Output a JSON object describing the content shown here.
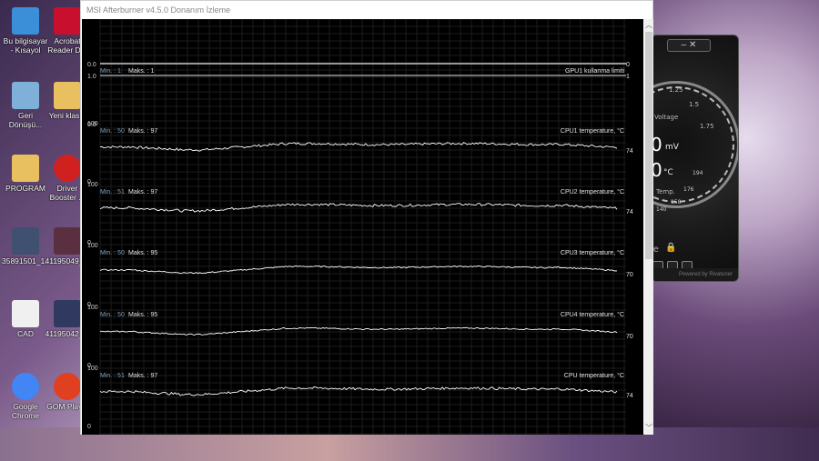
{
  "window": {
    "title": "MSI Afterburner v4.5.0 Donanım İzleme"
  },
  "graphs": [
    {
      "name": "GPU1 kullanma limiti",
      "min_label": "Min. :",
      "min_value": "1",
      "max_label": "Maks. :",
      "max_value": "1",
      "ytop": "1.0",
      "ybottom": "0.0",
      "current": "0",
      "current2": "1",
      "color": "#ffffff"
    },
    {
      "name": "CPU1 temperature, °C",
      "min_label": "Min. :",
      "min_value": "50",
      "max_label": "Maks. :",
      "max_value": "97",
      "ytop": "100",
      "ybottom": "0",
      "current": "74",
      "color": "#ffffff"
    },
    {
      "name": "CPU2 temperature, °C",
      "min_label": "Min. :",
      "min_value": "51",
      "max_label": "Maks. :",
      "max_value": "97",
      "ytop": "100",
      "ybottom": "0",
      "current": "74",
      "color": "#ffffff"
    },
    {
      "name": "CPU3 temperature, °C",
      "min_label": "Min. :",
      "min_value": "50",
      "max_label": "Maks. :",
      "max_value": "95",
      "ytop": "100",
      "ybottom": "0",
      "current": "70",
      "color": "#ffffff"
    },
    {
      "name": "CPU4 temperature, °C",
      "min_label": "Min. :",
      "min_value": "50",
      "max_label": "Maks. :",
      "max_value": "95",
      "ytop": "100",
      "ybottom": "0",
      "current": "70",
      "color": "#ffffff"
    },
    {
      "name": "CPU temperature, °C",
      "min_label": "Min. :",
      "min_value": "51",
      "max_label": "Maks. :",
      "max_value": "97",
      "ytop": "100",
      "ybottom": "0",
      "current": "74",
      "color": "#ffffff"
    }
  ],
  "first_graph_top_label": "0.0",
  "desktop_icons": [
    {
      "label": "Bu bilgisayar",
      "label2": "- Kısayol",
      "icon": "computer-icon",
      "color": "#3a8fd8"
    },
    {
      "label": "Acrobat",
      "label2": "Reader D...",
      "icon": "pdf-icon",
      "color": "#c8102e"
    },
    {
      "label": "Geri",
      "label2": "Dönüşü...",
      "icon": "recycle-bin-icon",
      "color": "#7fb0d8"
    },
    {
      "label": "Yeni klas...",
      "label2": "",
      "icon": "folder-icon",
      "color": "#e8c060"
    },
    {
      "label": "PROGRAM",
      "label2": "",
      "icon": "program-folder-icon",
      "color": "#e8c060"
    },
    {
      "label": "Driver",
      "label2": "Booster ...",
      "icon": "driver-booster-icon",
      "color": "#d02020"
    },
    {
      "label": "35891501_1...",
      "label2": "",
      "icon": "image-icon",
      "color": "#405070"
    },
    {
      "label": "41195049_...",
      "label2": "",
      "icon": "image-icon",
      "color": "#5a3040"
    },
    {
      "label": "CAD",
      "label2": "",
      "icon": "cad-icon",
      "color": "#f0f0f0"
    },
    {
      "label": "41195042_...",
      "label2": "",
      "icon": "image-icon",
      "color": "#303a60"
    },
    {
      "label": "Google",
      "label2": "Chrome",
      "icon": "chrome-icon",
      "color": "#4285f4"
    },
    {
      "label": "GOM Play...",
      "label2": "",
      "icon": "gom-player-icon",
      "color": "#e04020"
    }
  ],
  "widget": {
    "voltage_label": "Voltage",
    "mv_value": "0",
    "mv_unit": "mV",
    "temp_value": "0",
    "temp_unit": "°C",
    "temp_label": "Temp.",
    "tick_194": "194",
    "tick_176": "176",
    "tick_158": "158",
    "tick_140": "140",
    "tick_1_25": "1.25",
    "tick_1_5": "1.5",
    "tick_1_75": "1.75",
    "footer": "Powered by Rivatuner",
    "profile_label": "le"
  }
}
